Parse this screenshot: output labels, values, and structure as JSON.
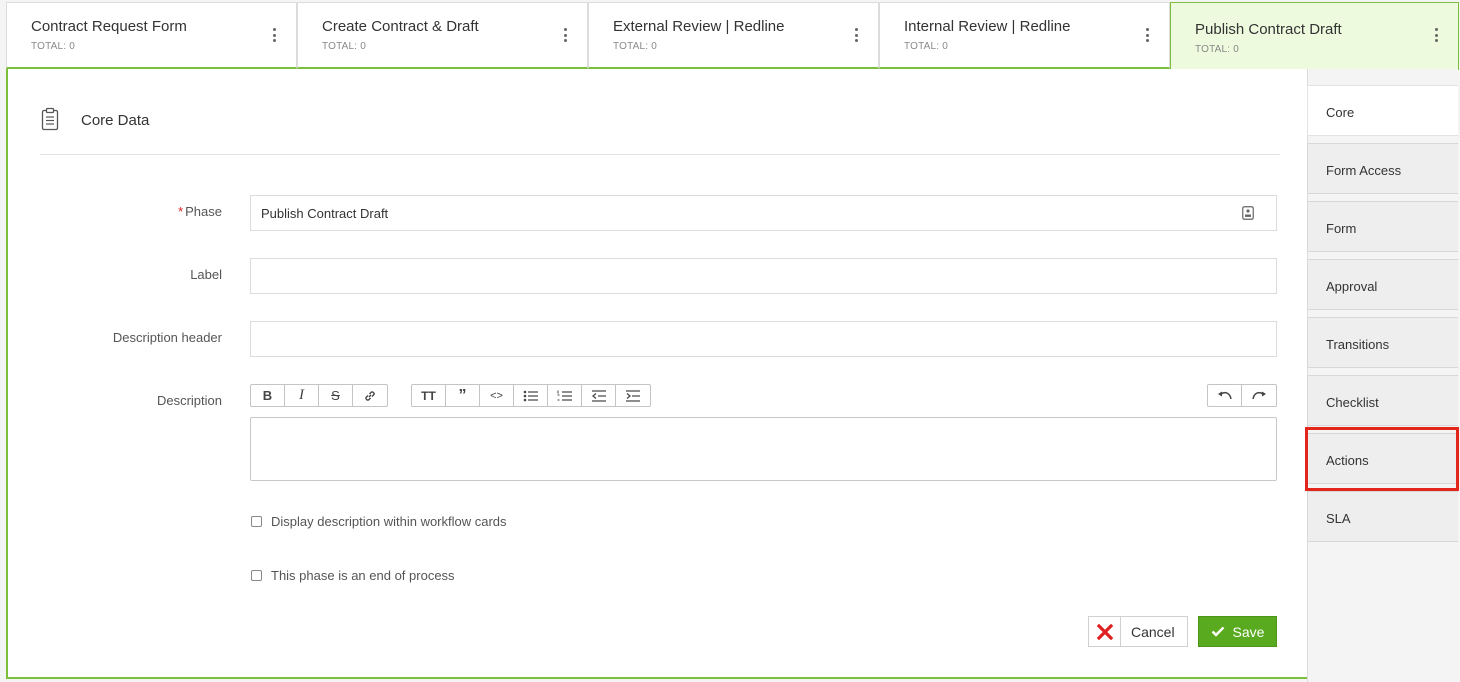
{
  "phase_tabs": [
    {
      "title": "Contract Request Form",
      "total": "TOTAL: 0"
    },
    {
      "title": "Create Contract & Draft",
      "total": "TOTAL: 0"
    },
    {
      "title": "External Review | Redline",
      "total": "TOTAL: 0"
    },
    {
      "title": "Internal Review | Redline",
      "total": "TOTAL: 0"
    },
    {
      "title": "Publish Contract Draft",
      "total": "TOTAL: 0"
    }
  ],
  "section": {
    "title": "Core Data"
  },
  "form": {
    "phase_label": "Phase",
    "required_mark": "*",
    "phase_value": "Publish Contract Draft",
    "label_label": "Label",
    "label_value": "",
    "desc_header_label": "Description header",
    "desc_header_value": "",
    "description_label": "Description",
    "display_in_cards_label": "Display description within workflow cards",
    "end_of_process_label": "This phase is an end of process"
  },
  "buttons": {
    "cancel": "Cancel",
    "save": "Save"
  },
  "sidebar": {
    "items": [
      {
        "label": "Core"
      },
      {
        "label": "Form Access"
      },
      {
        "label": "Form"
      },
      {
        "label": "Approval"
      },
      {
        "label": "Transitions"
      },
      {
        "label": "Checklist"
      },
      {
        "label": "Actions"
      },
      {
        "label": "SLA"
      }
    ]
  },
  "colors": {
    "accent_green": "#7bbf3a",
    "save_green": "#5aaa1f",
    "highlight_red": "#e3261c",
    "cancel_red": "#e02020"
  }
}
